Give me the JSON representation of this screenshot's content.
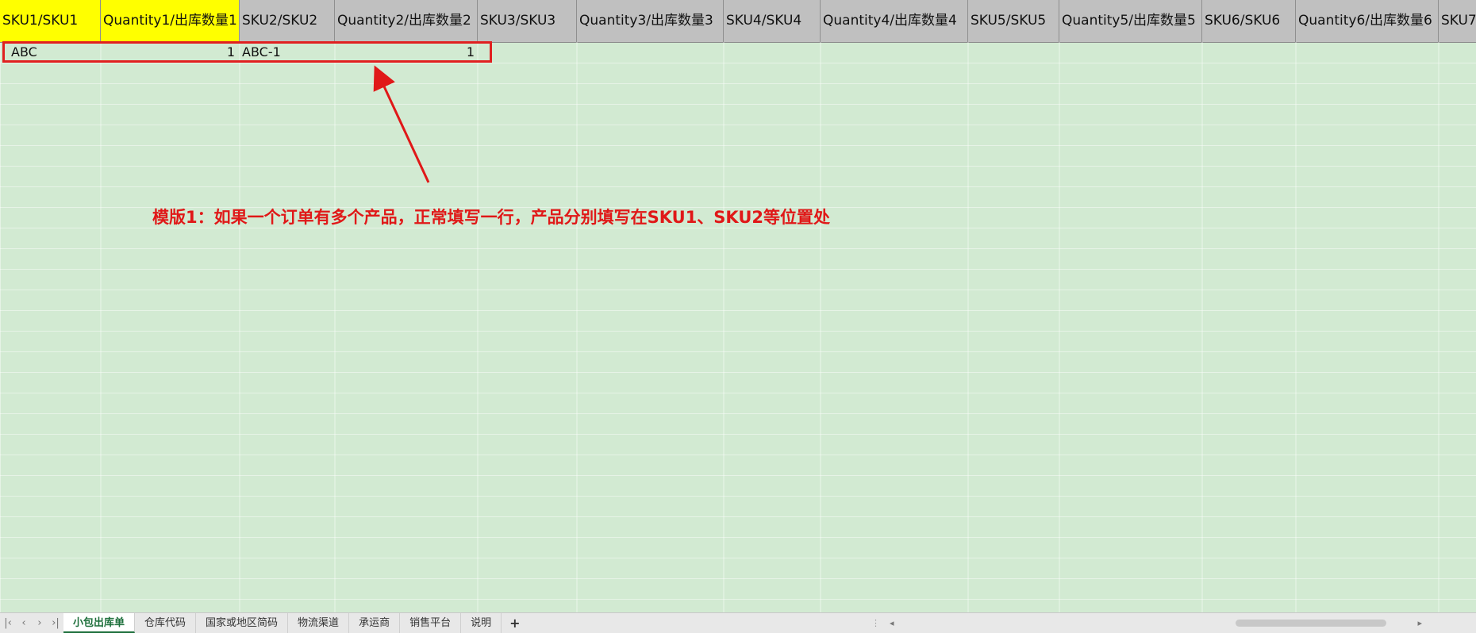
{
  "headers": [
    {
      "label": "SKU1/SKU1",
      "highlight": true
    },
    {
      "label": "Quantity1/出库数量1",
      "highlight": true
    },
    {
      "label": "SKU2/SKU2",
      "highlight": false
    },
    {
      "label": "Quantity2/出库数量2",
      "highlight": false
    },
    {
      "label": "SKU3/SKU3",
      "highlight": false
    },
    {
      "label": "Quantity3/出库数量3",
      "highlight": false
    },
    {
      "label": "SKU4/SKU4",
      "highlight": false
    },
    {
      "label": "Quantity4/出库数量4",
      "highlight": false
    },
    {
      "label": "SKU5/SKU5",
      "highlight": false
    },
    {
      "label": "Quantity5/出库数量5",
      "highlight": false
    },
    {
      "label": "SKU6/SKU6",
      "highlight": false
    },
    {
      "label": "Quantity6/出库数量6",
      "highlight": false
    },
    {
      "label": "SKU7/",
      "highlight": false
    }
  ],
  "row1": {
    "sku1": "ABC",
    "quantity1": "1",
    "sku2": "ABC-1",
    "quantity2": "1"
  },
  "annotation": "模版1：如果一个订单有多个产品，正常填写一行，产品分别填写在SKU1、SKU2等位置处",
  "sheet_tabs": [
    "小包出库单",
    "仓库代码",
    "国家或地区简码",
    "物流渠道",
    "承运商",
    "销售平台",
    "说明"
  ],
  "active_tab": "小包出库单",
  "nav": {
    "prev": "‹",
    "next": "›",
    "last": "›|",
    "first": "|‹",
    "add": "+"
  },
  "colors": {
    "annotation": "#e01818",
    "highlight_header": "#ffff00",
    "sheet_bg": "#d2ead2",
    "header_bg": "#c0c0c0"
  }
}
